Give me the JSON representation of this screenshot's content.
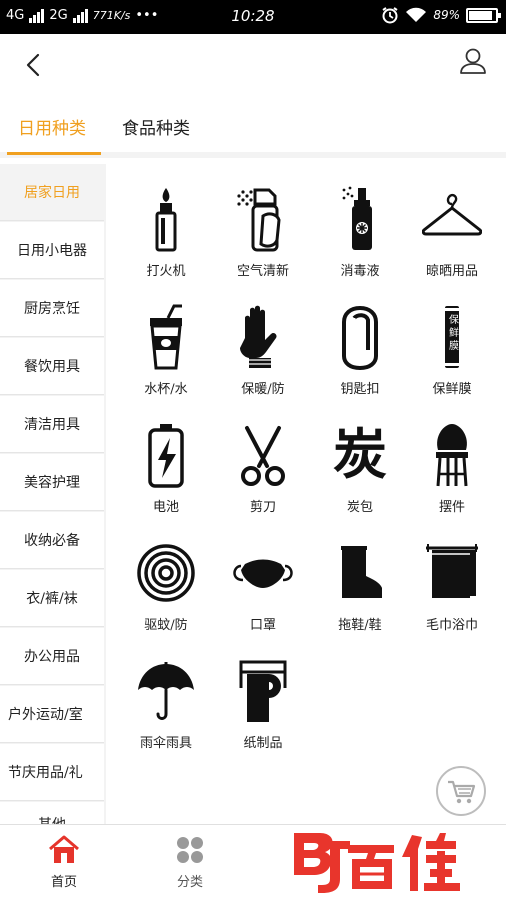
{
  "status_bar": {
    "network1": "4G",
    "network2": "2G",
    "speed": "771K/s",
    "dots": "•••",
    "time": "10:28",
    "battery": "89%"
  },
  "tabs": [
    {
      "label": "日用种类",
      "active": true
    },
    {
      "label": "食品种类",
      "active": false
    }
  ],
  "sidebar": {
    "items": [
      {
        "label": "居家日用",
        "active": true
      },
      {
        "label": "日用小电器",
        "active": false
      },
      {
        "label": "厨房烹饪",
        "active": false
      },
      {
        "label": "餐饮用具",
        "active": false
      },
      {
        "label": "清洁用具",
        "active": false
      },
      {
        "label": "美容护理",
        "active": false
      },
      {
        "label": "收纳必备",
        "active": false
      },
      {
        "label": "衣/裤/袜",
        "active": false
      },
      {
        "label": "办公用品",
        "active": false
      },
      {
        "label": "户外运动/室",
        "active": false
      },
      {
        "label": "节庆用品/礼",
        "active": false
      },
      {
        "label": "其他",
        "active": false
      }
    ]
  },
  "grid": {
    "items": [
      {
        "label": "打火机",
        "icon": "lighter-icon"
      },
      {
        "label": "空气清新",
        "icon": "air-freshener-icon"
      },
      {
        "label": "消毒液",
        "icon": "disinfectant-spray-icon"
      },
      {
        "label": "晾晒用品",
        "icon": "hanger-icon"
      },
      {
        "label": "水杯/水",
        "icon": "cup-icon"
      },
      {
        "label": "保暖/防",
        "icon": "glove-icon"
      },
      {
        "label": "钥匙扣",
        "icon": "carabiner-icon"
      },
      {
        "label": "保鲜膜",
        "icon": "cling-film-icon",
        "icon_text": "保鲜膜"
      },
      {
        "label": "电池",
        "icon": "battery-icon"
      },
      {
        "label": "剪刀",
        "icon": "scissors-icon"
      },
      {
        "label": "炭包",
        "icon": "charcoal-icon",
        "icon_text": "炭"
      },
      {
        "label": "摆件",
        "icon": "chair-icon"
      },
      {
        "label": "驱蚊/防",
        "icon": "mosquito-coil-icon"
      },
      {
        "label": "口罩",
        "icon": "mask-icon"
      },
      {
        "label": "拖鞋/鞋",
        "icon": "boot-icon"
      },
      {
        "label": "毛巾浴巾",
        "icon": "towel-icon"
      },
      {
        "label": "雨伞雨具",
        "icon": "umbrella-icon"
      },
      {
        "label": "纸制品",
        "icon": "toilet-paper-icon"
      }
    ]
  },
  "bottom_nav": {
    "items": [
      {
        "label": "首页",
        "icon": "home-icon",
        "active": true
      },
      {
        "label": "分类",
        "icon": "category-icon",
        "active": false
      }
    ],
    "brand_text": "BJ百佳"
  },
  "colors": {
    "accent": "#f0a020",
    "home_active": "#e5342b",
    "brand_red": "#e8352c"
  }
}
